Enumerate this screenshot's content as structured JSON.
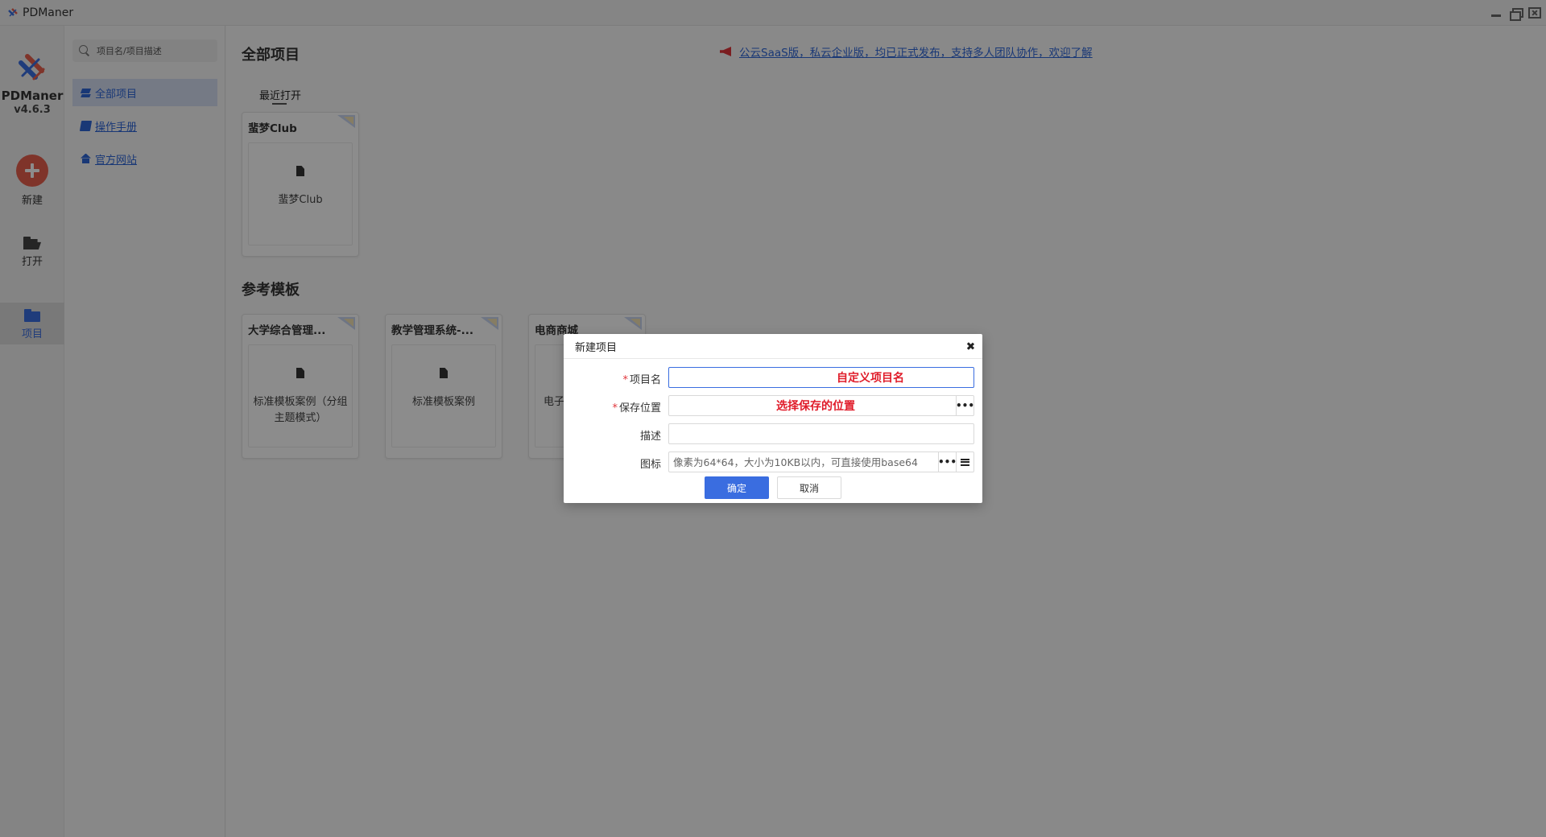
{
  "window": {
    "title": "PDManer"
  },
  "rail": {
    "brand": "PDManer",
    "version": "v4.6.3",
    "new_label": "新建",
    "open_label": "打开",
    "project_label": "项目"
  },
  "sidebar": {
    "search_placeholder": "项目名/项目描述",
    "items": [
      {
        "label": "全部项目",
        "icon": "layers-icon",
        "active": true
      },
      {
        "label": "操作手册",
        "icon": "book-icon",
        "active": false
      },
      {
        "label": "官方网站",
        "icon": "home-icon",
        "active": false
      }
    ]
  },
  "main": {
    "title": "全部项目",
    "notice": "公云SaaS版，私云企业版，均已正式发布，支持多人团队协作，欢迎了解",
    "recent_tab": "最近打开",
    "recent_projects": [
      {
        "title": "蜚梦Club",
        "desc": "蜚梦Club"
      }
    ],
    "templates_title": "参考模板",
    "templates": [
      {
        "title": "大学综合管理...",
        "desc": "标准模板案例（分组主题模式）"
      },
      {
        "title": "教学管理系统-...",
        "desc": "标准模板案例"
      },
      {
        "title": "电商商城",
        "desc": "电子"
      }
    ]
  },
  "dialog": {
    "title": "新建项目",
    "fields": {
      "name_label": "项目名",
      "name_value": "",
      "name_hint": "自定义项目名",
      "path_label": "保存位置",
      "path_value": "",
      "path_hint": "选择保存的位置",
      "desc_label": "描述",
      "desc_value": "",
      "icon_label": "图标",
      "icon_placeholder": "像素为64*64，大小为10KB以内，可直接使用base64"
    },
    "ok_label": "确定",
    "cancel_label": "取消"
  },
  "colors": {
    "accent": "#3a6de0",
    "danger": "#e01c2a",
    "new_button": "#e7604e"
  }
}
